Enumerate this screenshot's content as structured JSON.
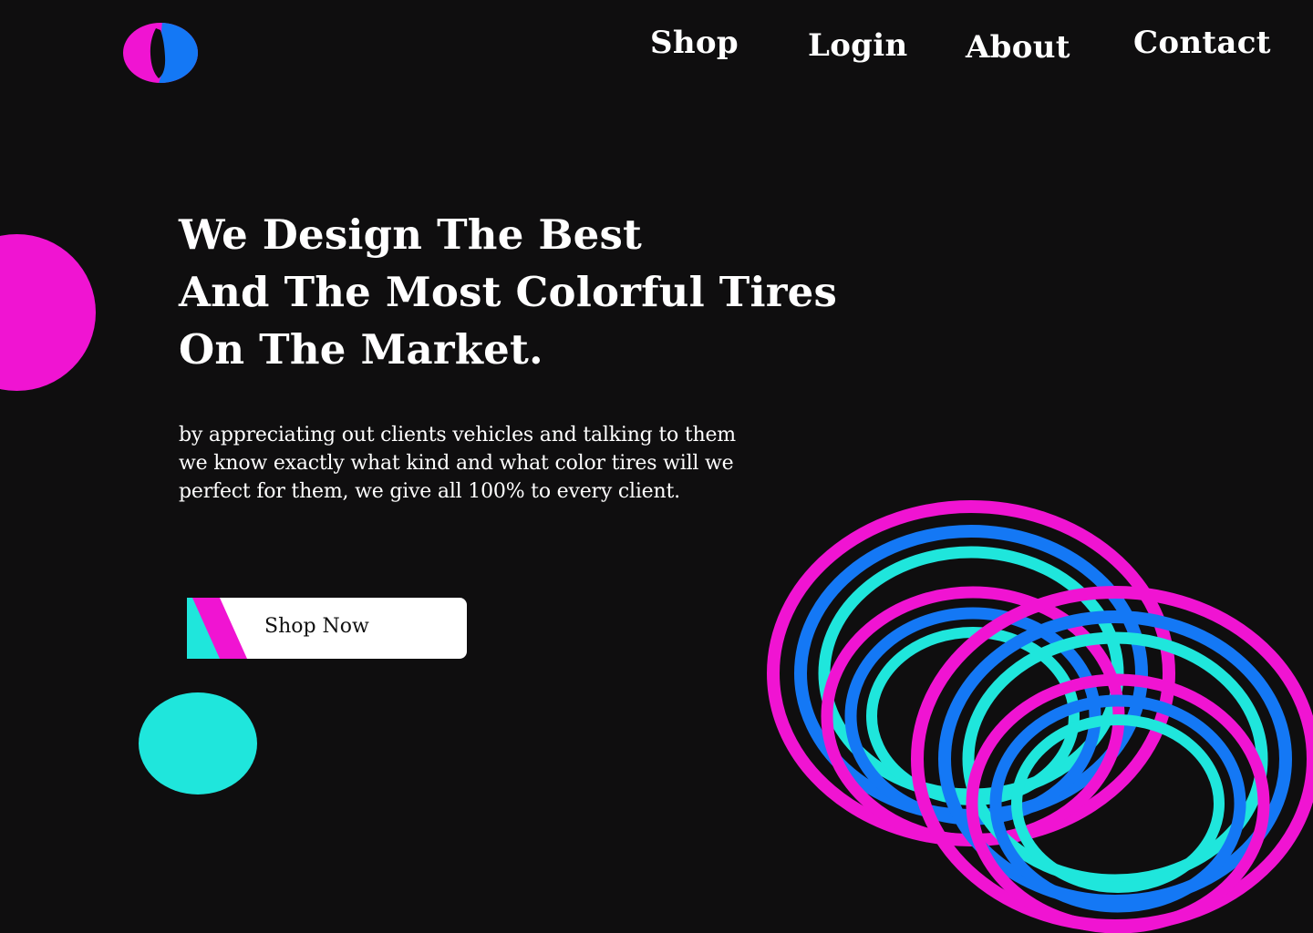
{
  "brand": {
    "logo_icon": "tire-logo-icon",
    "colors": {
      "magenta": "#f014d2",
      "blue": "#1478f5",
      "cyan": "#1fe6dc",
      "background": "#0f0e0f"
    }
  },
  "nav": {
    "items": [
      {
        "label": "Shop"
      },
      {
        "label": "Login"
      },
      {
        "label": "About"
      },
      {
        "label": "Contact"
      }
    ]
  },
  "hero": {
    "headline": [
      "We Design The Best",
      "And The Most Colorful Tires",
      "On The Market."
    ],
    "description": [
      "by appreciating out clients vehicles and talking to them",
      "we know exactly what kind and what color tires will we",
      "perfect for them, we give all 100% to every client."
    ],
    "cta_label": "Shop Now",
    "illustration_icon": "tire-rings-illustration"
  }
}
